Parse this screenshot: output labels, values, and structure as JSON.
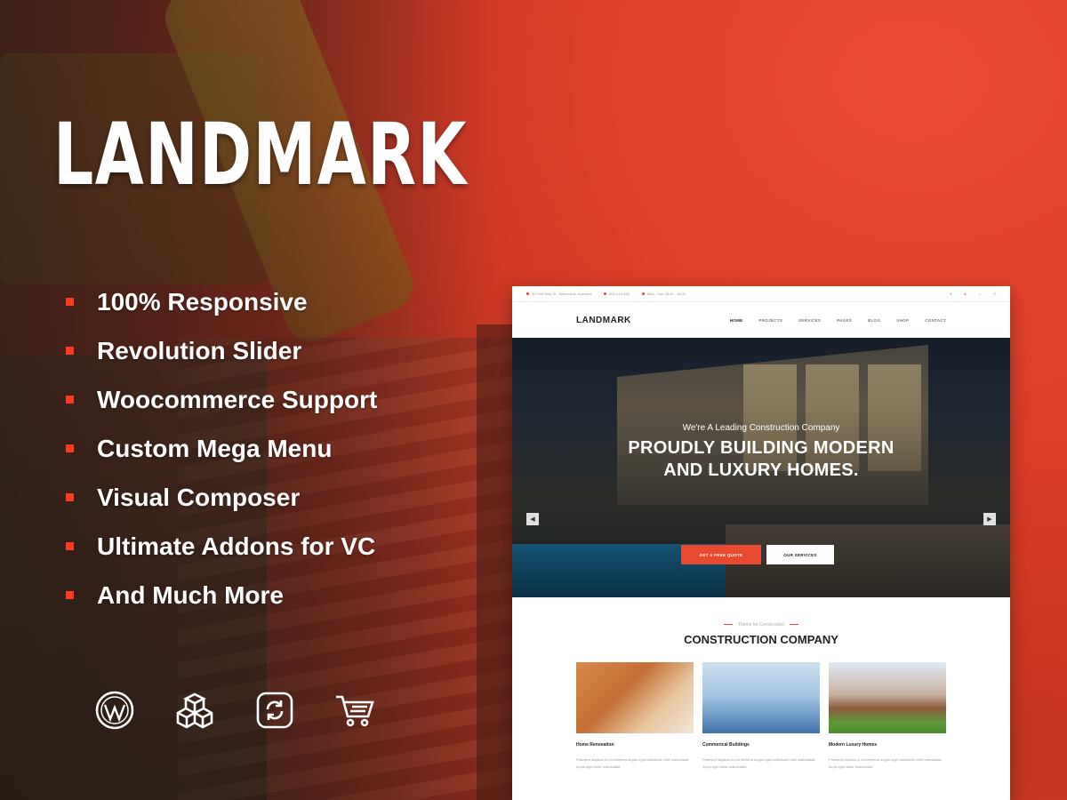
{
  "brand": {
    "title": "LANDMARK",
    "accent_color": "#e84a2f"
  },
  "features": [
    "100% Responsive",
    "Revolution Slider",
    "Woocommerce Support",
    "Custom Mega Menu",
    "Visual Composer",
    "Ultimate Addons for VC",
    "And Much More"
  ],
  "bottom_icons": [
    "wordpress-icon",
    "cube-stack-icon",
    "refresh-icon",
    "cart-icon"
  ],
  "mockup": {
    "topbar": {
      "address": "35 First Way St - Melbourne, Australia",
      "phone": "800-123-456",
      "hours": "Mon - Sun 08:00 - 18:00"
    },
    "logo": "LANDMARK",
    "menu": [
      "HOME",
      "PROJECTS",
      "SERVICES",
      "PAGES",
      "BLOG",
      "SHOP",
      "CONTACT"
    ],
    "hero": {
      "subtitle": "We're A Leading Construction Company",
      "title_line1": "PROUDLY BUILDING MODERN",
      "title_line2": "AND LUXURY HOMES.",
      "primary_button": "GET A FREE QUOTE",
      "secondary_button": "OUR SERVICES"
    },
    "section": {
      "kicker": "Theme for Construction",
      "title": "CONSTRUCTION COMPANY"
    },
    "cards": [
      {
        "title": "Home Renovation",
        "desc": "Praesent dapibus is not eleifend augue eget sollicitudin with malesuada turpis eget dolor malesuada"
      },
      {
        "title": "Commerical Buildings",
        "desc": "Praesent dapibus is not eleifend augue eget sollicitudin with malesuada turpis eget dolor malesuada"
      },
      {
        "title": "Modern Luxury Homes",
        "desc": "Praesent dapibus is not eleifend augue eget sollicitudin with malesuada turpis eget dolor malesuada"
      }
    ]
  }
}
